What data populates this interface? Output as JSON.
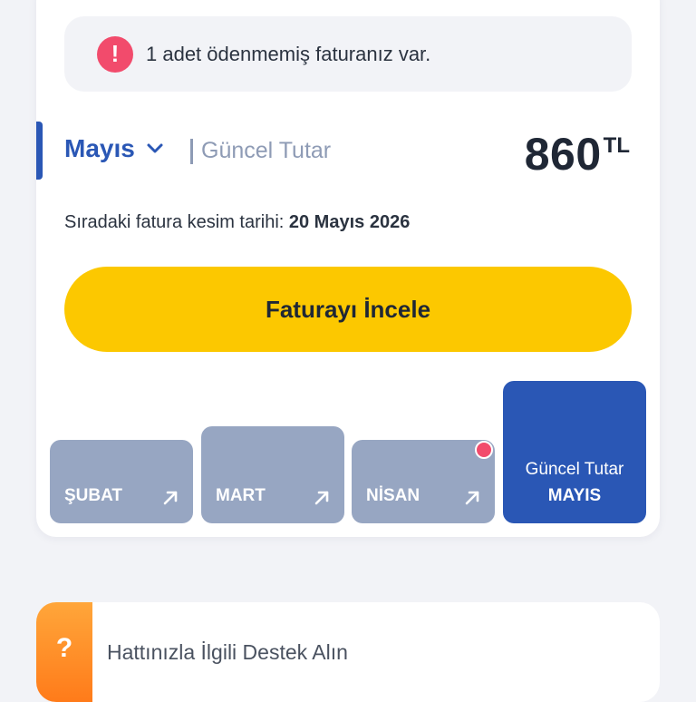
{
  "alert": {
    "icon": "exclamation-icon",
    "icon_glyph": "!",
    "text": "1 adet ödenmemiş faturanız var."
  },
  "summary": {
    "month": "Mayıs",
    "label": "Güncel Tutar",
    "amount": "860",
    "currency": "TL"
  },
  "next_invoice": {
    "prefix": "Sıradaki fatura kesim tarihi: ",
    "date": "20 Mayıs 2026"
  },
  "cta": {
    "label": "Faturayı İncele"
  },
  "months": [
    {
      "label": "ŞUBAT",
      "icon": "arrow-up-right-icon"
    },
    {
      "label": "MART",
      "icon": "arrow-up-right-icon"
    },
    {
      "label": "NİSAN",
      "icon": "arrow-up-right-icon",
      "unpaid_dot": true
    }
  ],
  "current_tile": {
    "line1": "Güncel Tutar",
    "line2": "MAYIS"
  },
  "support": {
    "icon_glyph": "?",
    "text": "Hattınızla İlgili Destek Alın"
  },
  "colors": {
    "primary_blue": "#2a57b5",
    "cta_yellow": "#fcc800",
    "alert_red": "#f24b6c",
    "tile_gray": "#97a6c2",
    "support_orange": "#ff8c22"
  }
}
